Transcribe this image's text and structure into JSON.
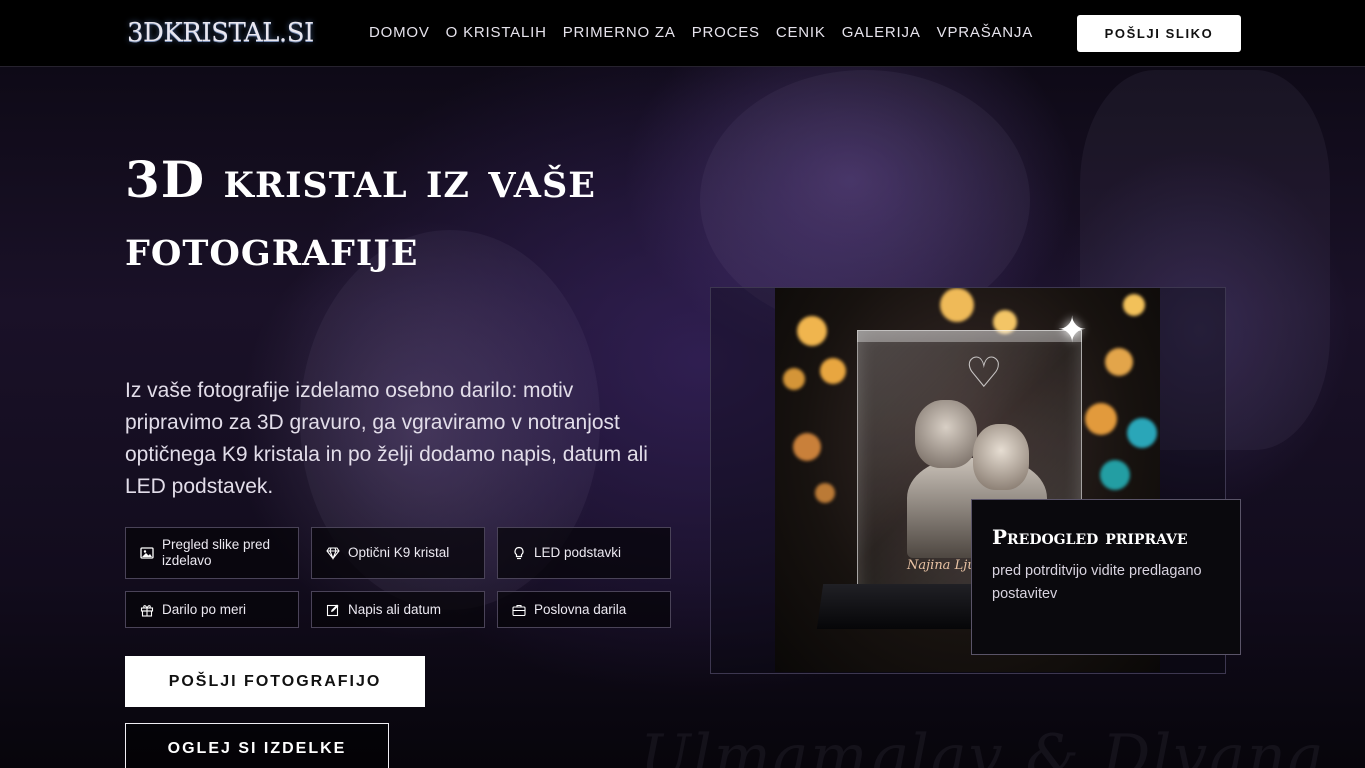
{
  "brand": {
    "logo_text": "3DKRISTAL.SI"
  },
  "nav": {
    "items": [
      "DOMOV",
      "O KRISTALIH",
      "PRIMERNO ZA",
      "PROCES",
      "CENIK",
      "GALERIJA",
      "VPRAŠANJA"
    ],
    "cta_label": "POŠLJI SLIKO"
  },
  "hero": {
    "title": "3D kristal iz vaše fotografije",
    "lead": "Iz vaše fotografije izdelamo osebno darilo: motiv pripravimo za 3D gravuro, ga vgraviramo v notranjost optičnega K9 kristala in po želji dodamo napis, datum ali LED podstavek.",
    "features": [
      {
        "label": "Pregled slike pred izdelavo",
        "icon": "image-icon"
      },
      {
        "label": "Optični K9 kristal",
        "icon": "diamond-icon"
      },
      {
        "label": "LED podstavki",
        "icon": "lightbulb-icon"
      },
      {
        "label": "Darilo po meri",
        "icon": "gift-icon"
      },
      {
        "label": "Napis ali datum",
        "icon": "edit-icon"
      },
      {
        "label": "Poslovna darila",
        "icon": "briefcase-icon"
      }
    ],
    "primary_button": "POŠLJI FOTOGRAFIJO",
    "secondary_button": "OGLEJ SI IZDELKE"
  },
  "preview": {
    "title": "Predogled priprave",
    "text": "pred potrditvijo vidite predlagano postavitev"
  },
  "theme": {
    "background": "#08060d",
    "accent_purple": "#2b1d45",
    "button_bg": "#ffffff",
    "button_text": "#111111"
  }
}
